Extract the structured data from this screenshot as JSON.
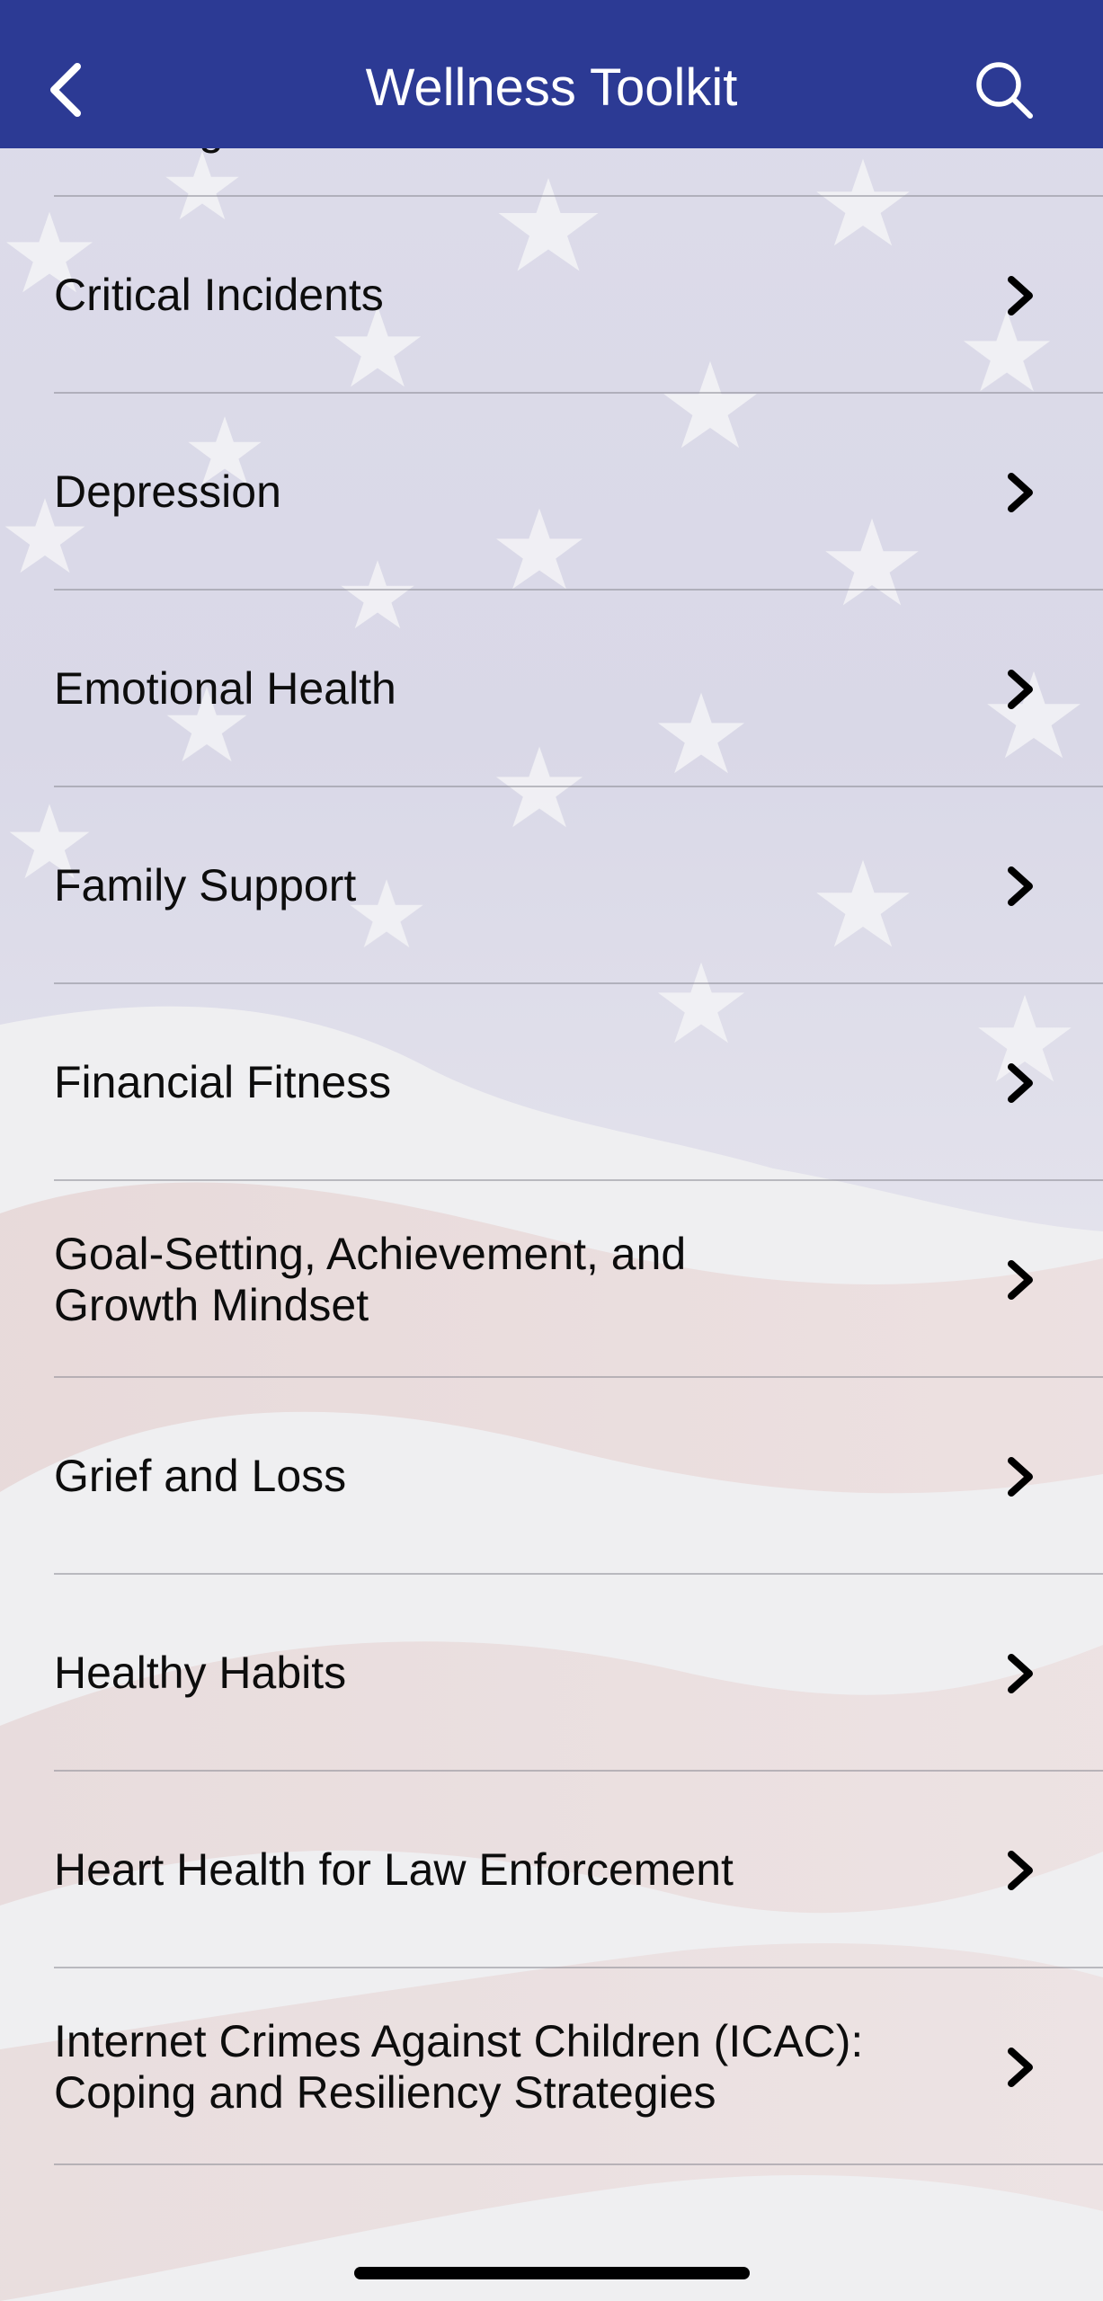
{
  "header": {
    "title": "Wellness Toolkit",
    "back_icon": "chevron-left-icon",
    "search_icon": "search-icon",
    "background": "#2c3a94"
  },
  "list": {
    "items": [
      {
        "label": "Creating a Culture of Wellness"
      },
      {
        "label": "Critical Incidents"
      },
      {
        "label": "Depression"
      },
      {
        "label": "Emotional Health"
      },
      {
        "label": "Family Support"
      },
      {
        "label": "Financial Fitness"
      },
      {
        "label": "Goal-Setting, Achievement, and Growth Mindset"
      },
      {
        "label": "Grief and Loss"
      },
      {
        "label": "Healthy Habits"
      },
      {
        "label": "Heart Health for Law Enforcement"
      },
      {
        "label": "Internet Crimes Against Children (ICAC): Coping and Resiliency Strategies"
      }
    ],
    "row_icon": "chevron-right-icon"
  }
}
